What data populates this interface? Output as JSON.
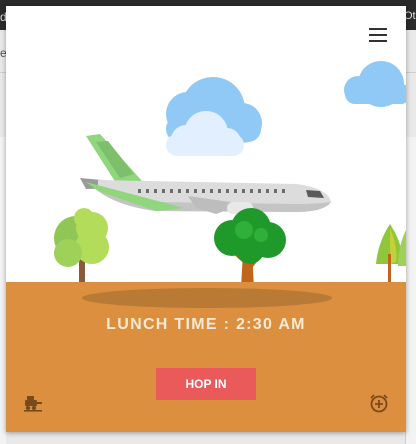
{
  "app": {
    "lunch_label": "LUNCH TIME : 2:30 AM",
    "button_label": "HOP IN"
  },
  "background": {
    "tab_left_char": "d",
    "tab_right_text": "Oth",
    "page_left_char": "e"
  },
  "icons": {
    "menu": "hamburger-menu-icon",
    "left_bottom": "transport-filter-icon",
    "right_bottom": "add-alarm-icon"
  },
  "colors": {
    "ground": "#db8f3f",
    "button": "#ea5a5a",
    "cloud": "#90c9f5",
    "plane_tail": "#8fd67c",
    "tree_dark": "#1f9a2a",
    "tree_light": "#a9d65b"
  }
}
